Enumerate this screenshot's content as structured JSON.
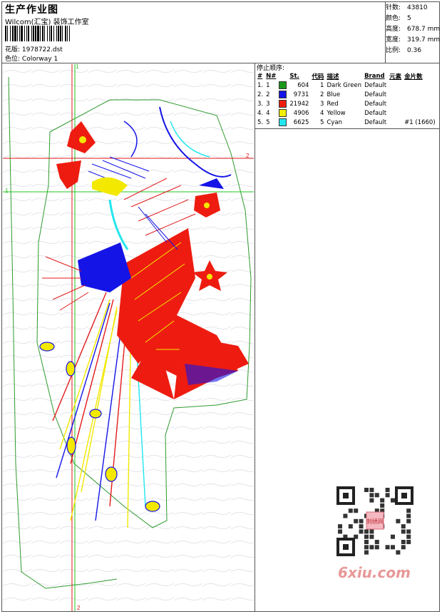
{
  "header": {
    "title": "生产作业图",
    "studio": "Wilcom(汇宝) 装饰工作室",
    "pattern_label": "花版:",
    "pattern_value": "1978722.dst",
    "colorway_label": "色位:",
    "colorway_value": "Colorway 1"
  },
  "stats": [
    {
      "label": "针数:",
      "value": "43810"
    },
    {
      "label": "颜色:",
      "value": "5"
    },
    {
      "label": "高度:",
      "value": "678.7 mm"
    },
    {
      "label": "宽度:",
      "value": "319.7 mm"
    },
    {
      "label": "比例:",
      "value": "0.36"
    }
  ],
  "guides": {
    "v1_top": "1",
    "v2_bottom": "2",
    "h1_left": "1",
    "h2_right": "2"
  },
  "stops": {
    "title": "停止顺序:",
    "columns": [
      "#",
      "N#",
      "St.",
      "代码",
      "描述",
      "Brand",
      "元素",
      "金片数"
    ],
    "rows": [
      {
        "idx": "1.",
        "n": "1",
        "color": "#1a9a1a",
        "st": "604",
        "code": "1",
        "desc": "Dark Green",
        "brand": "Default",
        "elem": "",
        "sequin": ""
      },
      {
        "idx": "2.",
        "n": "2",
        "color": "#1414e6",
        "st": "9731",
        "code": "2",
        "desc": "Blue",
        "brand": "Default",
        "elem": "",
        "sequin": ""
      },
      {
        "idx": "3.",
        "n": "3",
        "color": "#ee1c10",
        "st": "21942",
        "code": "3",
        "desc": "Red",
        "brand": "Default",
        "elem": "",
        "sequin": ""
      },
      {
        "idx": "4.",
        "n": "4",
        "color": "#f2f000",
        "st": "4906",
        "code": "4",
        "desc": "Yellow",
        "brand": "Default",
        "elem": "",
        "sequin": ""
      },
      {
        "idx": "5.",
        "n": "5",
        "color": "#22e6ee",
        "st": "6625",
        "code": "5",
        "desc": "Cyan",
        "brand": "Default",
        "elem": "",
        "sequin": "#1 (1660)"
      }
    ]
  },
  "watermark": {
    "site": "6xiu.com",
    "badge": "刺绣网"
  }
}
